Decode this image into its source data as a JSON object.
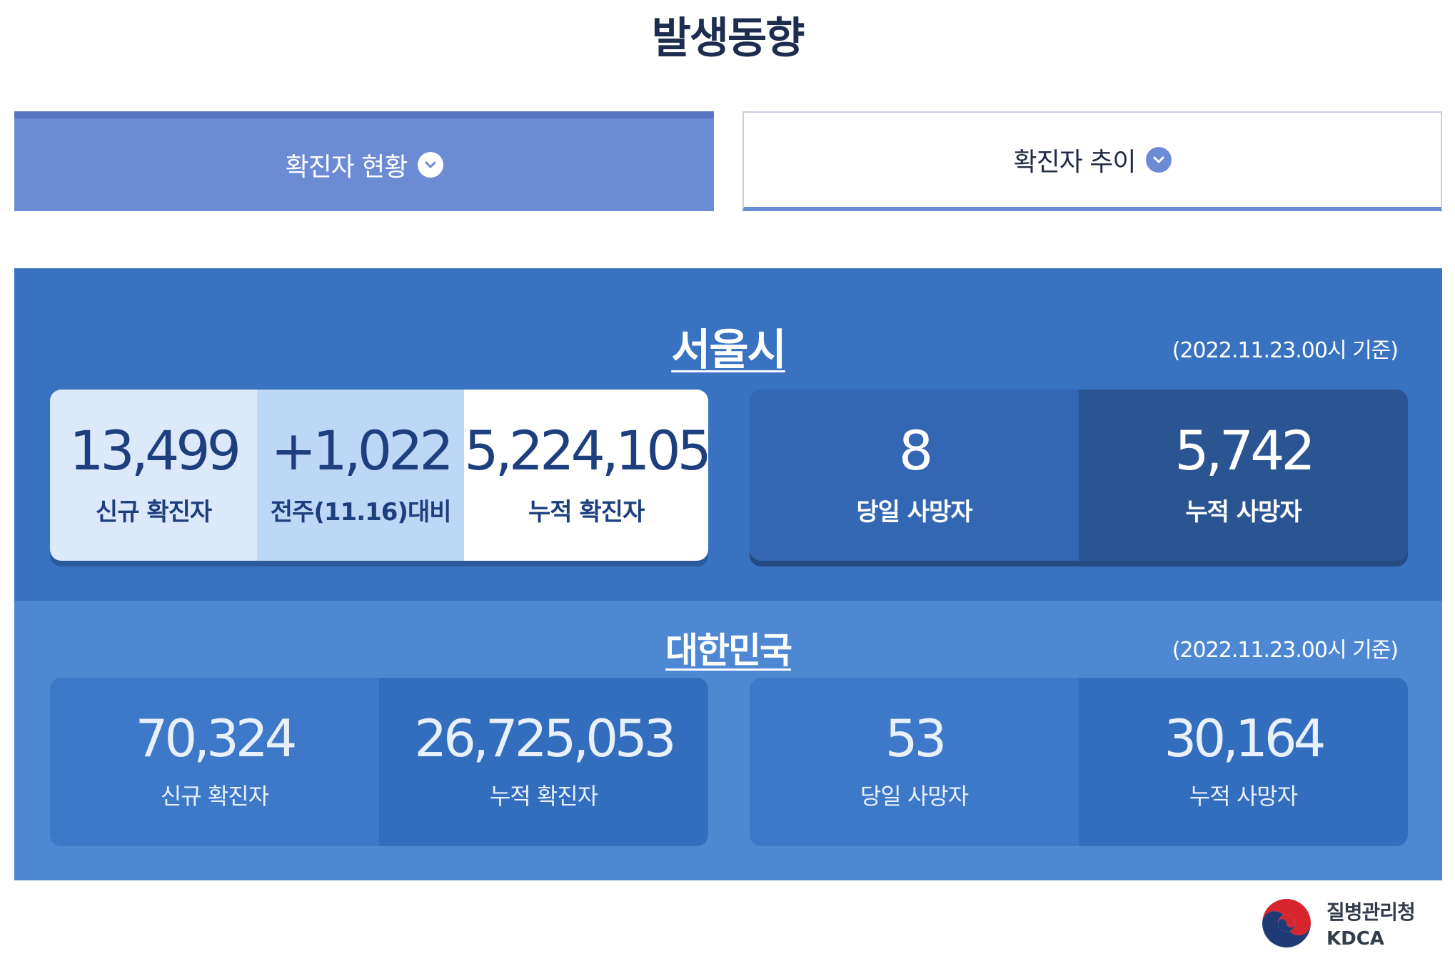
{
  "page": {
    "title": "발생동향"
  },
  "tabs": {
    "active_label": "확진자 현황",
    "inactive_label": "확진자 추이"
  },
  "seoul": {
    "region": "서울시",
    "basis": "(2022.11.23.00시 기준)",
    "new_confirmed": {
      "value": "13,499",
      "label": "신규 확진자"
    },
    "week_change": {
      "value": "+1,022",
      "label": "전주(11.16)대비"
    },
    "cumulative_confirmed": {
      "value": "5,224,105",
      "label": "누적 확진자"
    },
    "deaths_today": {
      "value": "8",
      "label": "당일 사망자"
    },
    "cumulative_deaths": {
      "value": "5,742",
      "label": "누적 사망자"
    }
  },
  "korea": {
    "region": "대한민국",
    "basis": "(2022.11.23.00시 기준)",
    "new_confirmed": {
      "value": "70,324",
      "label": "신규 확진자"
    },
    "cumulative_confirmed": {
      "value": "26,725,053",
      "label": "누적 확진자"
    },
    "deaths_today": {
      "value": "53",
      "label": "당일 사망자"
    },
    "cumulative_deaths": {
      "value": "30,164",
      "label": "누적 사망자"
    }
  },
  "logo": {
    "name_ko": "질병관리청",
    "name_en": "KDCA"
  },
  "colors": {
    "tab_active": "#6c8bd5",
    "seoul_panel": "#3972c1",
    "korea_panel": "#4f88d2"
  },
  "icons": {
    "tab_chevron": "chevron-down-icon",
    "logo": "taegeuk-emblem-icon"
  }
}
